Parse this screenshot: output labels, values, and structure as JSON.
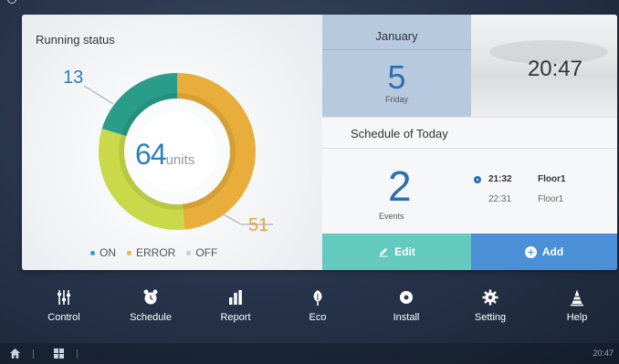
{
  "running_status": {
    "title": "Running status",
    "total": "64",
    "total_unit": "units",
    "on_count": "13",
    "off_count": "51",
    "segments": [
      {
        "state": "ON",
        "value": 13,
        "color": "#2a9d8a"
      },
      {
        "state": "ERROR",
        "value": 20,
        "color": "#c9d94a"
      },
      {
        "state": "OFF",
        "value": 31,
        "color": "#e8ad3a"
      }
    ],
    "legend": [
      {
        "label": "ON",
        "color": "#2aa6b5"
      },
      {
        "label": "ERROR",
        "color": "#e8b63a"
      },
      {
        "label": "OFF",
        "color": "#c7cbd1"
      }
    ]
  },
  "date": {
    "month": "January",
    "day": "5",
    "weekday": "Friday"
  },
  "clock": {
    "time": "20:47"
  },
  "schedule": {
    "title": "Schedule of Today",
    "events_count": "2",
    "events_label": "Events",
    "events": [
      {
        "time": "21:32",
        "place": "Floor1",
        "active": true
      },
      {
        "time": "22:31",
        "place": "Floor1",
        "active": false
      }
    ]
  },
  "actions": {
    "edit_label": "Edit",
    "add_label": "Add"
  },
  "nav": [
    {
      "label": "Control",
      "icon": "sliders-icon"
    },
    {
      "label": "Schedule",
      "icon": "alarm-clock-icon"
    },
    {
      "label": "Report",
      "icon": "bar-chart-icon"
    },
    {
      "label": "Eco",
      "icon": "eco-leaf-icon"
    },
    {
      "label": "Install",
      "icon": "install-disc-icon"
    },
    {
      "label": "Setting",
      "icon": "gear-icon"
    },
    {
      "label": "Help",
      "icon": "cone-icon"
    }
  ],
  "footer": {
    "time": "20:47",
    "home_icon": "home-icon",
    "grid_icon": "grid-icon"
  },
  "colors": {
    "accent_blue": "#2c6fb3",
    "edit_teal": "#64c9be",
    "add_blue": "#4b8fd6",
    "date_panel": "#b6c9de"
  }
}
